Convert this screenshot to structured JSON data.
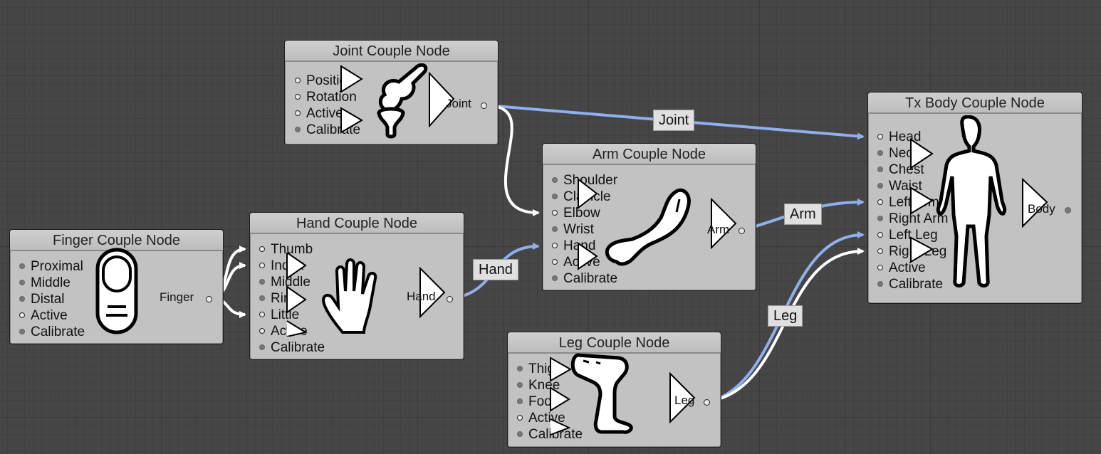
{
  "nodes": {
    "joint": {
      "title": "Joint Couple Node",
      "inputs": [
        "Position",
        "Rotation",
        "Active",
        "Calibrate"
      ],
      "output": "Joint"
    },
    "arm": {
      "title": "Arm Couple Node",
      "inputs": [
        "Shoulder",
        "Clavicle",
        "Elbow",
        "Wrist",
        "Hand",
        "Active",
        "Calibrate"
      ],
      "output": "Arm"
    },
    "hand": {
      "title": "Hand Couple Node",
      "inputs": [
        "Thumb",
        "Index",
        "Middle",
        "Ring",
        "Little",
        "Active",
        "Calibrate"
      ],
      "output": "Hand"
    },
    "finger": {
      "title": "Finger Couple Node",
      "inputs": [
        "Proximal",
        "Middle",
        "Distal",
        "Active",
        "Calibrate"
      ],
      "output": "Finger"
    },
    "leg": {
      "title": "Leg Couple Node",
      "inputs": [
        "Thigh",
        "Knee",
        "Foot",
        "Active",
        "Calibrate"
      ],
      "output": "Leg"
    },
    "body": {
      "title": "Tx Body Couple Node",
      "inputs": [
        "Head",
        "Neck",
        "Chest",
        "Waist",
        "Left Arm",
        "Right Arm",
        "Left Leg",
        "Right Leg",
        "Active",
        "Calibrate"
      ],
      "output": "Body"
    }
  },
  "wire_labels": {
    "joint": "Joint",
    "arm": "Arm",
    "hand": "Hand",
    "leg": "Leg"
  },
  "colors": {
    "background": "#464646",
    "node": "#c2c2c2",
    "wire_blue": "#8fb0ee",
    "wire_white": "#ffffff"
  },
  "icons": {
    "joint": "knee-joint-icon",
    "arm": "arm-icon",
    "hand": "hand-icon",
    "finger": "finger-icon",
    "leg": "leg-icon",
    "body": "human-body-icon"
  }
}
